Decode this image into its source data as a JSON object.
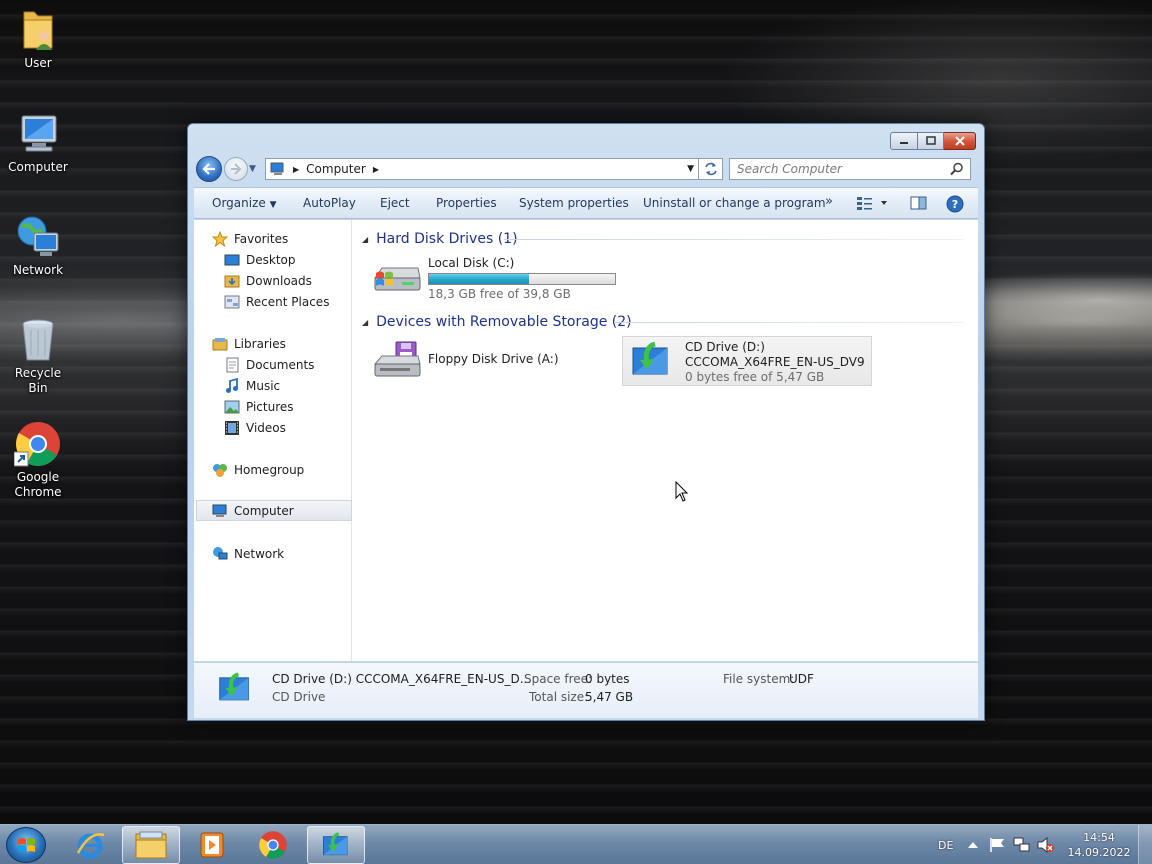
{
  "desktop": {
    "icons": [
      {
        "label": "User"
      },
      {
        "label": "Computer"
      },
      {
        "label": "Network"
      },
      {
        "label": "Recycle Bin"
      },
      {
        "label_line1": "Google",
        "label_line2": "Chrome"
      }
    ]
  },
  "window": {
    "address": {
      "root": "Computer"
    },
    "search": {
      "placeholder": "Search Computer"
    },
    "commands": {
      "organize": "Organize",
      "autoplay": "AutoPlay",
      "eject": "Eject",
      "properties": "Properties",
      "system_properties": "System properties",
      "uninstall": "Uninstall or change a program",
      "more": "»"
    },
    "nav": {
      "favorites": "Favorites",
      "desktop": "Desktop",
      "downloads": "Downloads",
      "recent_places": "Recent Places",
      "libraries": "Libraries",
      "documents": "Documents",
      "music": "Music",
      "pictures": "Pictures",
      "videos": "Videos",
      "homegroup": "Homegroup",
      "computer": "Computer",
      "network": "Network"
    },
    "groups": {
      "hdd_title": "Hard Disk Drives (1)",
      "removable_title": "Devices with Removable Storage (2)"
    },
    "drives": {
      "local_c": {
        "name": "Local Disk (C:)",
        "free": "18,3 GB free of 39,8 GB",
        "used_fraction": 0.54
      },
      "floppy": {
        "name": "Floppy Disk Drive (A:)"
      },
      "cd": {
        "name": "CD Drive (D:)",
        "label": "CCCOMA_X64FRE_EN-US_DV9",
        "free": "0 bytes free of 5,47 GB"
      }
    },
    "details": {
      "title": "CD Drive (D:) CCCOMA_X64FRE_EN-US_D...",
      "type": "CD Drive",
      "space_free_label": "Space free:",
      "space_free_value": "0 bytes",
      "total_size_label": "Total size:",
      "total_size_value": "5,47 GB",
      "fs_label": "File system:",
      "fs_value": "UDF"
    }
  },
  "taskbar": {
    "lang": "DE",
    "time": "14:54",
    "date": "14.09.2022"
  }
}
